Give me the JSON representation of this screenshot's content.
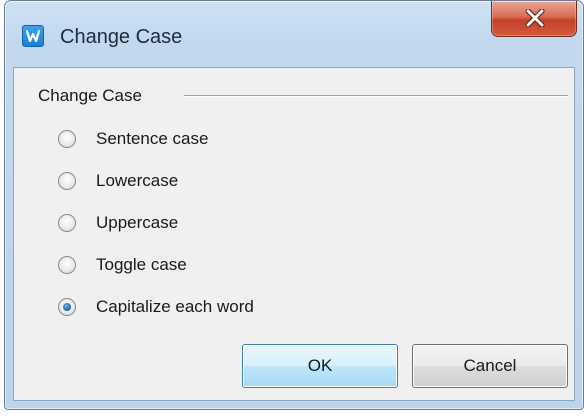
{
  "window": {
    "title": "Change Case",
    "app_icon": "wps-writer-icon",
    "close_icon": "close-icon"
  },
  "group": {
    "label": "Change Case"
  },
  "options": [
    {
      "label": "Sentence case",
      "checked": false
    },
    {
      "label": "Lowercase",
      "checked": false
    },
    {
      "label": "Uppercase",
      "checked": false
    },
    {
      "label": "Toggle case",
      "checked": false
    },
    {
      "label": "Capitalize each word",
      "checked": true
    }
  ],
  "buttons": {
    "ok_label": "OK",
    "cancel_label": "Cancel"
  },
  "colors": {
    "accent_ok_border": "#3c7fb1",
    "close_red": "#c4412a",
    "radio_dot": "#1f5fa8"
  }
}
